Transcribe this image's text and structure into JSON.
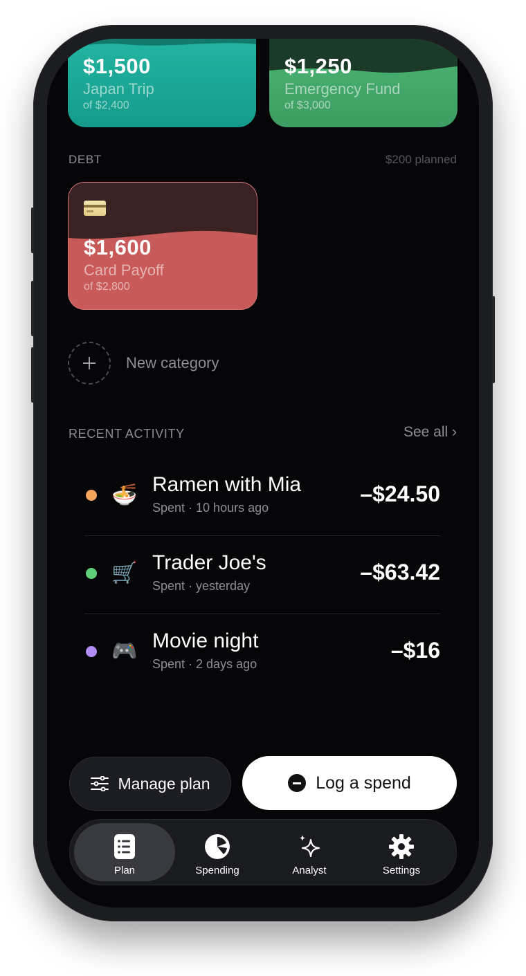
{
  "goals": [
    {
      "amount": "$1,500",
      "name": "Japan Trip",
      "of": "of $2,400",
      "progress": 0.625,
      "color": "#1fae9c"
    },
    {
      "amount": "$1,250",
      "name": "Emergency Fund",
      "of": "of $3,000",
      "progress": 0.42,
      "color": "#47ad6c"
    }
  ],
  "debt": {
    "label": "DEBT",
    "planned": "$200 planned",
    "card": {
      "icon": "credit-card-icon",
      "amount": "$1,600",
      "name": "Card Payoff",
      "of": "of $2,800",
      "progress": 0.57,
      "color": "#c85a5a"
    }
  },
  "new_category": {
    "label": "New category",
    "icon": "plus-icon"
  },
  "recent": {
    "label": "RECENT ACTIVITY",
    "see_all": "See all ›",
    "items": [
      {
        "title": "Ramen with Mia",
        "sub": "Spent · 10 hours ago",
        "amount": "–$24.50",
        "icon": "ramen-icon",
        "glyph": "🍜",
        "dot_color": "#f4a55a"
      },
      {
        "title": "Trader Joe's",
        "sub": "Spent · yesterday",
        "amount": "–$63.42",
        "icon": "shopping-cart-icon",
        "glyph": "🛒",
        "dot_color": "#5fcf7a"
      },
      {
        "title": "Movie night",
        "sub": "Spent · 2 days ago",
        "amount": "–$16",
        "icon": "game-controller-icon",
        "glyph": "🎮",
        "dot_color": "#b18cf5"
      }
    ]
  },
  "actions": {
    "manage": "Manage plan",
    "log": "Log a spend"
  },
  "tabs": [
    {
      "label": "Plan",
      "icon": "list-icon",
      "active": true
    },
    {
      "label": "Spending",
      "icon": "pie-chart-icon",
      "active": false
    },
    {
      "label": "Analyst",
      "icon": "sparkles-icon",
      "active": false
    },
    {
      "label": "Settings",
      "icon": "gear-icon",
      "active": false
    }
  ]
}
